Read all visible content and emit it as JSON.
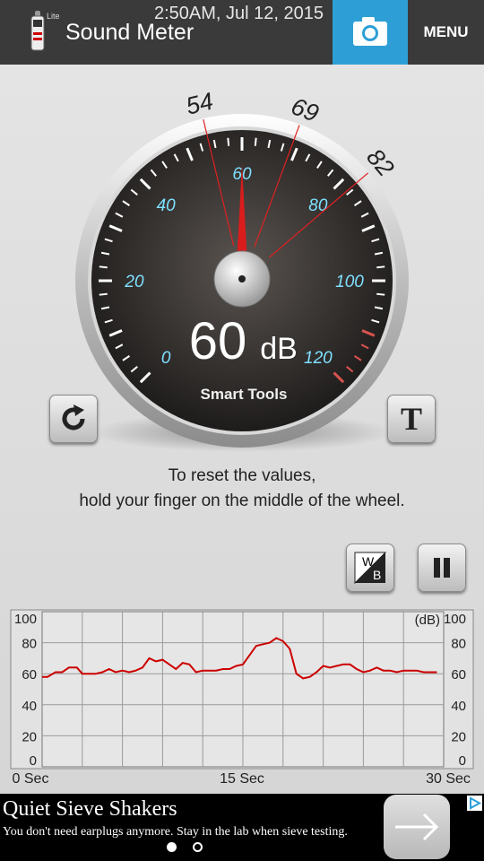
{
  "header": {
    "app_title": "Sound Meter",
    "lite_badge": "Lite",
    "datetime": "2:50AM, Jul 12, 2015",
    "menu_label": "MENU",
    "camera_icon": "camera-icon",
    "accent_color": "#2e9fd6"
  },
  "gauge": {
    "scale_labels": [
      "0",
      "20",
      "40",
      "60",
      "80",
      "100",
      "120"
    ],
    "min_marker": "54",
    "avg_marker": "69",
    "max_marker": "82",
    "reading_value": "60",
    "reading_unit": "dB",
    "brand": "Smart Tools",
    "needle_value": 60
  },
  "buttons": {
    "reset_icon": "refresh-icon",
    "text_label": "T",
    "wb_icon": "white-black-toggle-icon",
    "pause_icon": "pause-icon"
  },
  "instructions": {
    "line1": "To reset the values,",
    "line2": "hold your finger on the middle of the wheel."
  },
  "chart_data": {
    "type": "line",
    "ylabel_unit": "(dB)",
    "ylim": [
      0,
      100
    ],
    "y_ticks": [
      "0",
      "20",
      "40",
      "60",
      "80",
      "100"
    ],
    "x_ticks": [
      "0 Sec",
      "15 Sec",
      "30 Sec"
    ],
    "xlim": [
      0,
      30
    ],
    "grid": true,
    "series": [
      {
        "color": "#cc0000",
        "x": [
          0,
          0.4,
          1.0,
          1.5,
          2.0,
          2.6,
          3.0,
          3.5,
          4.0,
          4.5,
          5.0,
          5.5,
          6.0,
          6.5,
          7.0,
          7.5,
          8.0,
          8.5,
          9.0,
          9.5,
          10.0,
          10.5,
          11.0,
          11.5,
          12.0,
          12.5,
          13.0,
          13.5,
          14.0,
          14.5,
          15.0,
          15.5,
          16.0,
          16.5,
          17.0,
          17.5,
          18.0,
          18.5,
          19.0,
          19.5,
          20.0,
          20.5,
          21.0,
          21.5,
          22.0,
          22.5,
          23.0,
          23.5,
          24.0,
          24.5,
          25.0,
          25.5,
          26.0,
          26.5,
          27.0,
          27.5,
          28.0,
          28.5,
          29.0,
          29.5
        ],
        "y": [
          58,
          58,
          61,
          61,
          64,
          64,
          60,
          60,
          60,
          61,
          63,
          61,
          62,
          61,
          62,
          64,
          70,
          68,
          69,
          66,
          63,
          67,
          66,
          61,
          62,
          62,
          62,
          63,
          63,
          65,
          66,
          72,
          78,
          79,
          80,
          83,
          81,
          76,
          60,
          57,
          58,
          61,
          65,
          64,
          65,
          66,
          66,
          63,
          61,
          62,
          64,
          62,
          62,
          61,
          62,
          62,
          62,
          61,
          61,
          61
        ]
      }
    ]
  },
  "ad": {
    "title": "Quiet Sieve Shakers",
    "text": "You don't need earplugs anymore. Stay in the lab when sieve testing.",
    "arrow_icon": "arrow-right-icon",
    "choices_icon": "ad-choices-icon"
  }
}
